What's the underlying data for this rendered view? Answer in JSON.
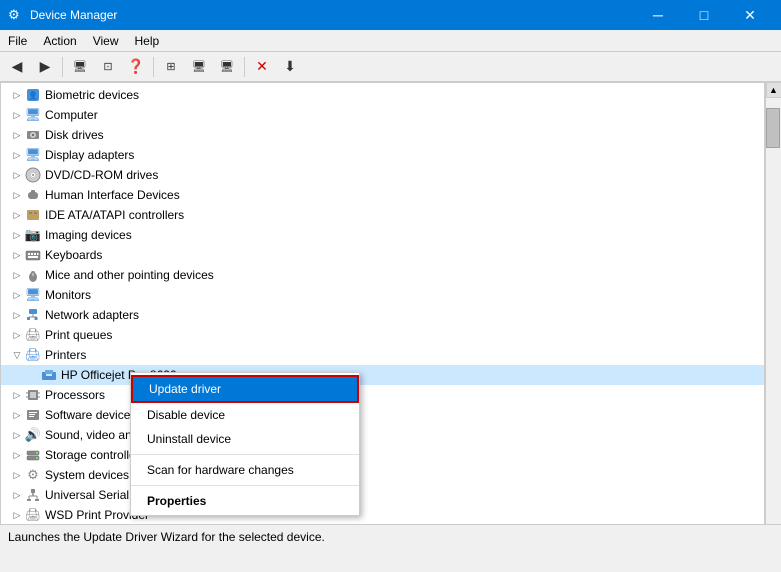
{
  "titleBar": {
    "title": "Device Manager",
    "icon": "⚙",
    "controls": {
      "minimize": "─",
      "maximize": "□",
      "close": "✕"
    }
  },
  "menuBar": {
    "items": [
      "File",
      "Action",
      "View",
      "Help"
    ]
  },
  "toolbar": {
    "buttons": [
      "◀",
      "▶",
      "🖥",
      "⊡",
      "❓",
      "⊞",
      "🖥",
      "🖥",
      "✕",
      "⬇"
    ]
  },
  "deviceTree": {
    "items": [
      {
        "label": "Biometric devices",
        "icon": "👤",
        "expanded": false,
        "indent": 0
      },
      {
        "label": "Computer",
        "icon": "💻",
        "expanded": false,
        "indent": 0
      },
      {
        "label": "Disk drives",
        "icon": "💾",
        "expanded": false,
        "indent": 0
      },
      {
        "label": "Display adapters",
        "icon": "🖥",
        "expanded": false,
        "indent": 0
      },
      {
        "label": "DVD/CD-ROM drives",
        "icon": "📀",
        "expanded": false,
        "indent": 0
      },
      {
        "label": "Human Interface Devices",
        "icon": "🖱",
        "expanded": false,
        "indent": 0
      },
      {
        "label": "IDE ATA/ATAPI controllers",
        "icon": "⚙",
        "expanded": false,
        "indent": 0
      },
      {
        "label": "Imaging devices",
        "icon": "📷",
        "expanded": false,
        "indent": 0
      },
      {
        "label": "Keyboards",
        "icon": "⌨",
        "expanded": false,
        "indent": 0
      },
      {
        "label": "Mice and other pointing devices",
        "icon": "🖱",
        "expanded": false,
        "indent": 0
      },
      {
        "label": "Monitors",
        "icon": "🖥",
        "expanded": false,
        "indent": 0
      },
      {
        "label": "Network adapters",
        "icon": "🌐",
        "expanded": false,
        "indent": 0
      },
      {
        "label": "Print queues",
        "icon": "🖨",
        "expanded": false,
        "indent": 0
      },
      {
        "label": "Printers",
        "icon": "🖨",
        "expanded": true,
        "indent": 0
      },
      {
        "label": "HP Officejet Pro 8620",
        "icon": "🖨",
        "expanded": false,
        "indent": 1,
        "selected": true
      },
      {
        "label": "Processors",
        "icon": "⚙",
        "expanded": false,
        "indent": 0
      },
      {
        "label": "Software devices",
        "icon": "⚙",
        "expanded": false,
        "indent": 0
      },
      {
        "label": "Sound, video and game...",
        "icon": "🔊",
        "expanded": false,
        "indent": 0
      },
      {
        "label": "Storage controllers",
        "icon": "💾",
        "expanded": false,
        "indent": 0
      },
      {
        "label": "System devices",
        "icon": "⚙",
        "expanded": false,
        "indent": 0
      },
      {
        "label": "Universal Serial Bus cor...",
        "icon": "⚙",
        "expanded": false,
        "indent": 0
      },
      {
        "label": "WSD Print Provider",
        "icon": "🖨",
        "expanded": false,
        "indent": 0
      }
    ]
  },
  "contextMenu": {
    "items": [
      {
        "label": "Update driver",
        "type": "highlighted"
      },
      {
        "label": "Disable device",
        "type": "normal"
      },
      {
        "label": "Uninstall device",
        "type": "normal"
      },
      {
        "type": "separator"
      },
      {
        "label": "Scan for hardware changes",
        "type": "normal"
      },
      {
        "type": "separator"
      },
      {
        "label": "Properties",
        "type": "bold"
      }
    ]
  },
  "statusBar": {
    "text": "Launches the Update Driver Wizard for the selected device."
  }
}
